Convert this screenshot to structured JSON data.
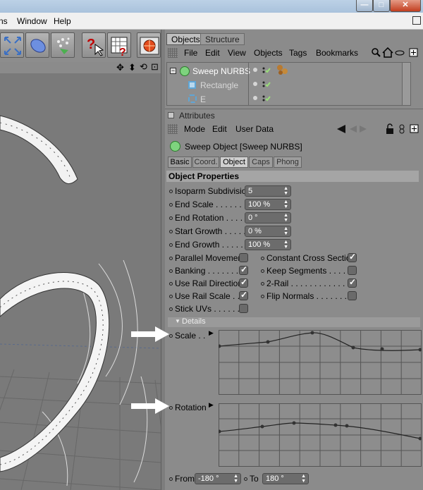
{
  "window": {
    "minimize_glyph": "—",
    "maximize_glyph": "□",
    "close_glyph": "✕"
  },
  "menubar": {
    "items": [
      "ns",
      "Window",
      "Help"
    ]
  },
  "toolbar": {
    "icons": [
      "move-icon",
      "deformer-icon",
      "particle-icon",
      "help-pointer-icon",
      "timeline-help-icon",
      "render-globe-icon"
    ]
  },
  "viewport": {
    "nav_icons": [
      "✥",
      "⬍",
      "⟲",
      "⊡"
    ]
  },
  "objects_panel": {
    "tabs": [
      "Objects",
      "Structure"
    ],
    "menu": [
      "File",
      "Edit",
      "View",
      "Objects",
      "Tags",
      "Bookmarks"
    ],
    "items": [
      {
        "name": "Sweep NURBS",
        "level": 0
      },
      {
        "name": "Rectangle",
        "level": 1
      },
      {
        "name": "E",
        "level": 1
      }
    ]
  },
  "attributes_panel": {
    "title": "Attributes",
    "menu": [
      "Mode",
      "Edit",
      "User Data"
    ],
    "object_title": "Sweep Object [Sweep NURBS]",
    "tabs": [
      "Basic",
      "Coord.",
      "Object",
      "Caps",
      "Phong"
    ],
    "active_tab": "Object",
    "section_title": "Object Properties",
    "fields": {
      "isoparm_label": "Isoparm Subdivision",
      "isoparm_value": "5",
      "end_scale_label": "End Scale . . . . . . . .",
      "end_scale_value": "100 %",
      "end_rotation_label": "End Rotation . . . . .",
      "end_rotation_value": "0 °",
      "start_growth_label": "Start Growth . . . . . .",
      "start_growth_value": "0 %",
      "end_growth_label": "End Growth . . . . . .",
      "end_growth_value": "100 %"
    },
    "checkboxes": {
      "parallel_movement": "Parallel Movement",
      "constant_cross_section": "Constant Cross Section",
      "banking": "Banking . . . . . . . . .",
      "keep_segments": "Keep Segments . . . . . .",
      "use_rail_direction": "Use Rail Direction",
      "two_rail": "2-Rail . . . . . . . . . . . . . .",
      "use_rail_scale": "Use Rail Scale . . .",
      "flip_normals": "Flip Normals . . . . . . . .",
      "stick_uvs": "Stick UVs . . . . . . ."
    },
    "details_label": "Details",
    "scale_label": "Scale . .",
    "rotation_label": "Rotation",
    "from_label": "From",
    "from_value": "-180 °",
    "to_label": "To",
    "to_value": "180 °"
  },
  "colors": {
    "panel_bg": "#8b8b8b",
    "active_tab": "#c4c4c4",
    "check_green": "#9adf7a"
  }
}
